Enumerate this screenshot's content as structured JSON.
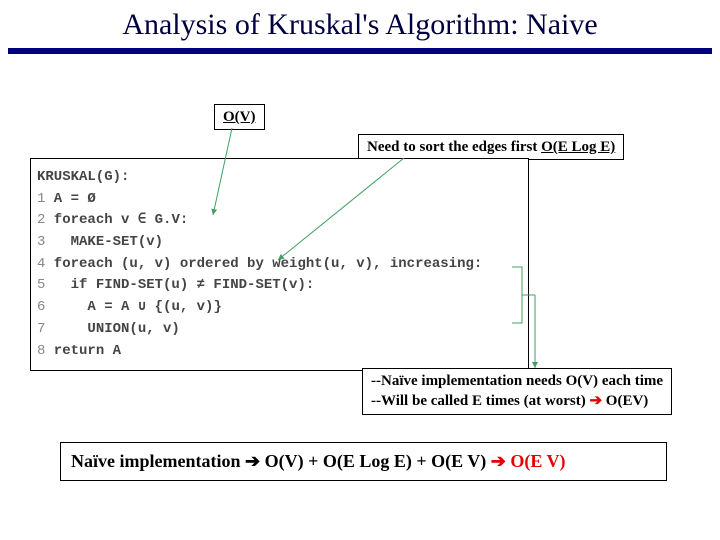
{
  "title": "Analysis of Kruskal's Algorithm: Naive",
  "annotations": {
    "ov": {
      "label": "O(V)"
    },
    "sort": {
      "prefix": "Need to sort the edges first ",
      "complexity": "O(E Log E)"
    },
    "naive": {
      "line1_prefix": "--Naïve implementation needs ",
      "line1_bold": "O(V)",
      "line1_suffix": " each time",
      "line2_prefix": "--Will be called ",
      "line2_mid": "E",
      "line2_suffix": " times (at worst) ",
      "line2_arrow": "➔",
      "line2_result": " O(EV)"
    }
  },
  "code": {
    "header": "KRUSKAL(G):",
    "lines": [
      {
        "n": "1",
        "txt": " A = Ø"
      },
      {
        "n": "2",
        "txt": " foreach v ∈ G.V:"
      },
      {
        "n": "3",
        "txt": "   MAKE-SET(v)"
      },
      {
        "n": "4",
        "txt": " foreach (u, v) ordered by weight(u, v), increasing:"
      },
      {
        "n": "5",
        "txt": "   if FIND-SET(u) ≠ FIND-SET(v):"
      },
      {
        "n": "6",
        "txt": "     A = A ∪ {(u, v)}"
      },
      {
        "n": "7",
        "txt": "     UNION(u, v)"
      },
      {
        "n": "8",
        "txt": " return A"
      }
    ]
  },
  "summary": {
    "prefix": "Naïve implementation ",
    "arrow1": "➔",
    "body": " O(V) + O(E Log E) + O(E V) ",
    "arrow2": "➔",
    "result_suffix": " O(E V)"
  },
  "colors": {
    "title_rule": "#000080",
    "arrow_red": "#e60000",
    "connector": "#40a060"
  }
}
